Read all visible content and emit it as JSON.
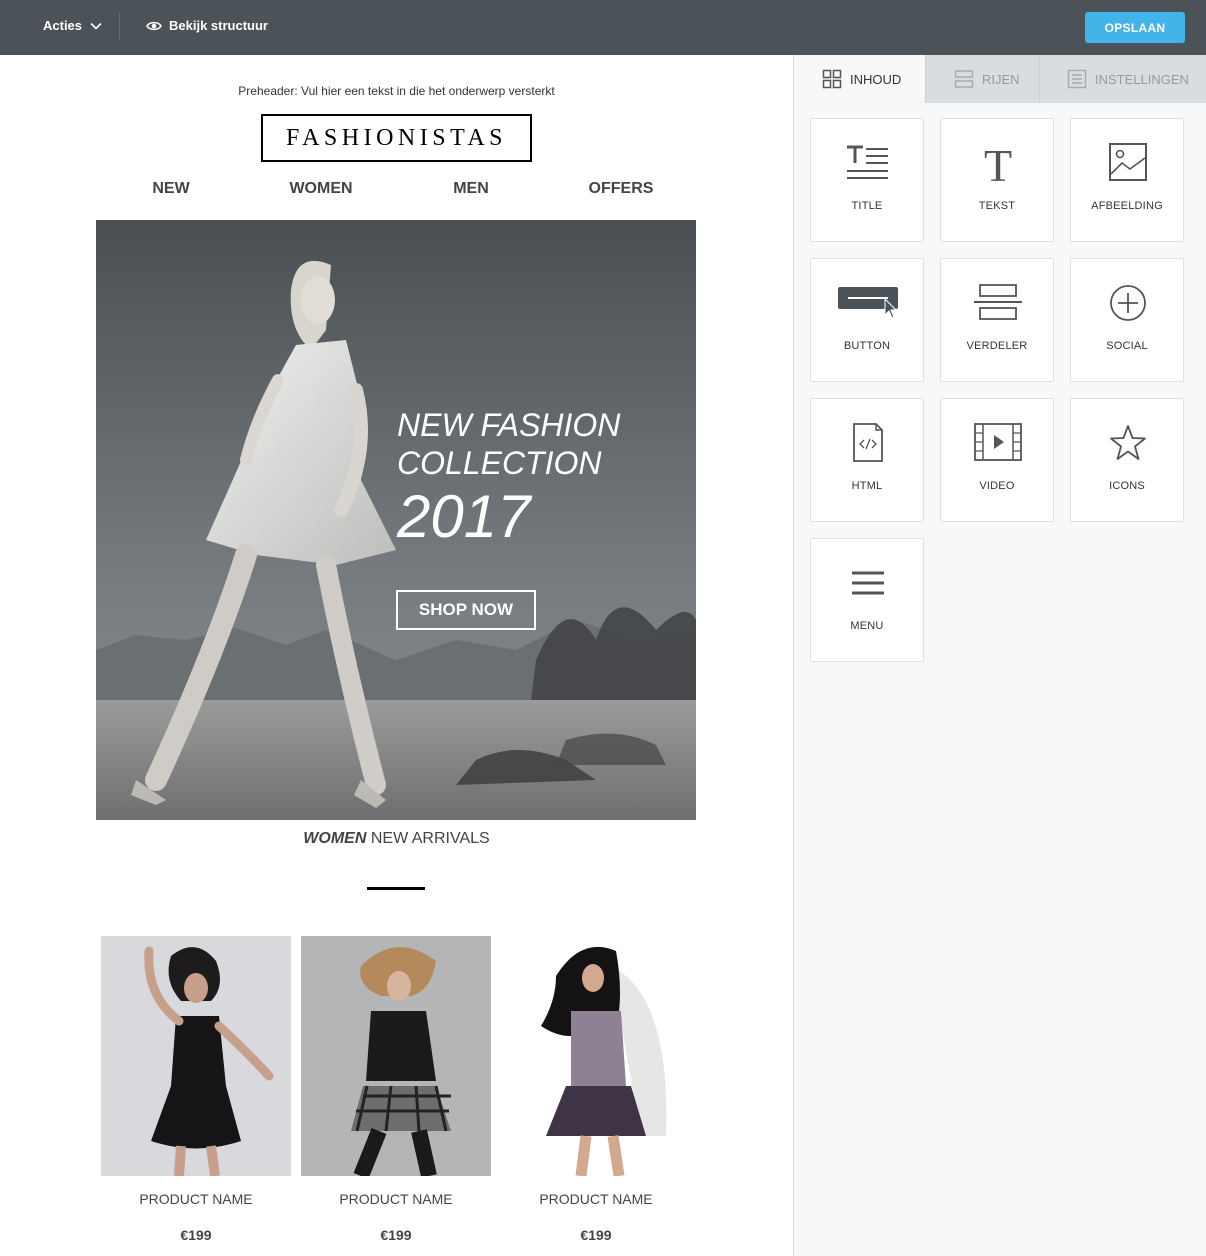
{
  "toolbar": {
    "actions_label": "Acties",
    "view_structure_label": "Bekijk structuur",
    "save_label": "OPSLAAN"
  },
  "email": {
    "preheader": "Preheader: Vul hier een tekst in die het onderwerp versterkt",
    "logo": "FASHIONISTAS",
    "nav": [
      "NEW",
      "WOMEN",
      "MEN",
      "OFFERS"
    ],
    "hero": {
      "title_line1": "NEW FASHION",
      "title_line2": "COLLECTION",
      "year": "2017",
      "button": "SHOP NOW"
    },
    "arrivals": {
      "bold": "WOMEN",
      "rest": " NEW ARRIVALS"
    },
    "products": [
      {
        "name": "PRODUCT NAME",
        "price": "€199"
      },
      {
        "name": "PRODUCT NAME",
        "price": "€199"
      },
      {
        "name": "PRODUCT NAME",
        "price": "€199"
      }
    ]
  },
  "panel": {
    "tabs": [
      {
        "label": "INHOUD",
        "icon": "grid-icon",
        "active": true
      },
      {
        "label": "RIJEN",
        "icon": "rows-icon",
        "active": false
      },
      {
        "label": "INSTELLINGEN",
        "icon": "settings-list-icon",
        "active": false
      }
    ],
    "tiles": [
      {
        "label": "TITLE",
        "icon": "title-icon"
      },
      {
        "label": "TEKST",
        "icon": "text-icon"
      },
      {
        "label": "AFBEELDING",
        "icon": "image-icon"
      },
      {
        "label": "BUTTON",
        "icon": "button-icon"
      },
      {
        "label": "VERDELER",
        "icon": "divider-icon"
      },
      {
        "label": "SOCIAL",
        "icon": "social-plus-icon"
      },
      {
        "label": "HTML",
        "icon": "html-file-icon"
      },
      {
        "label": "VIDEO",
        "icon": "video-icon"
      },
      {
        "label": "ICONS",
        "icon": "star-icon"
      },
      {
        "label": "MENU",
        "icon": "menu-icon"
      }
    ]
  },
  "colors": {
    "topbar": "#4b5358",
    "save_button": "#42b4ea",
    "panel_bg": "#f7f8f9",
    "tab_inactive_bg": "#dadddf"
  }
}
